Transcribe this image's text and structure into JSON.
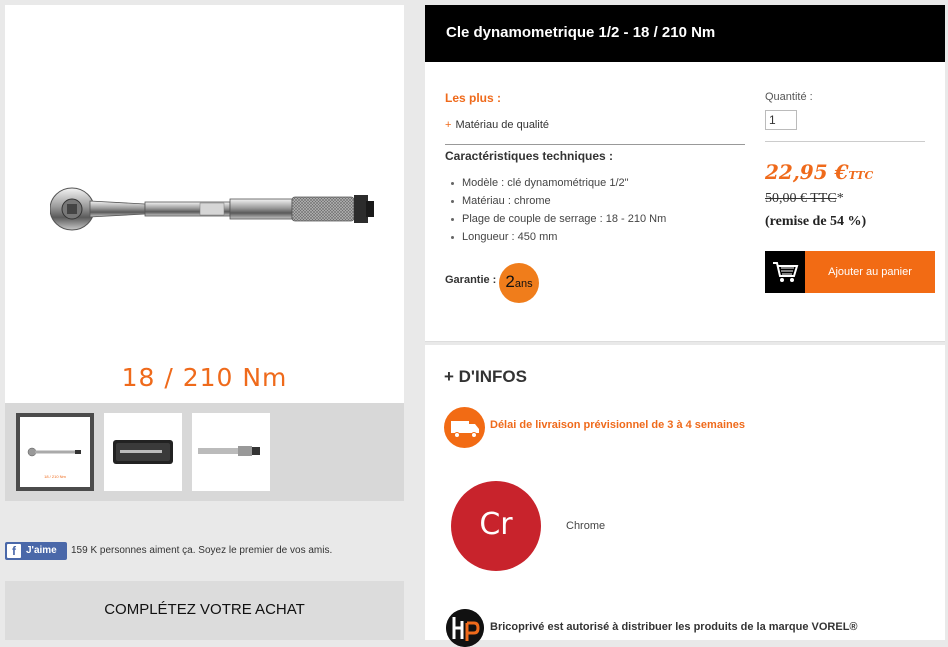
{
  "gallery": {
    "main_caption": "18 / 210 Nm",
    "thumb_caption": "18 / 210 Nm"
  },
  "social": {
    "like_button": "J'aime",
    "like_text": "159 K personnes aiment ça. Soyez le premier de vos amis."
  },
  "complete_purchase": "COMPLÉTEZ VOTRE ACHAT",
  "product": {
    "title": "Cle dynamometrique 1/2 - 18 / 210 Nm",
    "plus_label": "Les plus :",
    "plus_items": [
      {
        "marker": "+",
        "text": "Matériau de qualité"
      }
    ],
    "tech_title": "Caractéristiques techniques :",
    "specs": [
      "Modèle : clé dynamométrique 1/2\"",
      "Matériau : chrome",
      "Plage de couple de serrage : 18 - 210 Nm",
      "Longueur : 450 mm"
    ],
    "garantie_label": "Garantie :",
    "garantie_years": "2",
    "garantie_unit": "ans"
  },
  "purchase": {
    "quantity_label": "Quantité :",
    "quantity_value": "1",
    "price": "22,95 €",
    "price_suffix": "TTC",
    "old_price": "50,00 € TTC",
    "old_price_mark": "*",
    "discount": "(remise de 54 %)",
    "add_to_cart": "Ajouter au panier"
  },
  "infos": {
    "title": "+ D'INFOS",
    "delivery": "Délai de livraison prévisionnel de 3 à 4 semaines",
    "material_symbol": "Cr",
    "material_label": "Chrome",
    "brand_notice": "Bricoprivé est autorisé à distribuer les produits de la marque VOREL®"
  },
  "colors": {
    "accent": "#ef6a1b",
    "title_bar": "#000000",
    "chrome_badge": "#c8232c",
    "facebook": "#4a68a9"
  },
  "icons": [
    "cart-icon",
    "delivery-truck-icon",
    "facebook-icon",
    "bricoprive-logo-icon"
  ]
}
